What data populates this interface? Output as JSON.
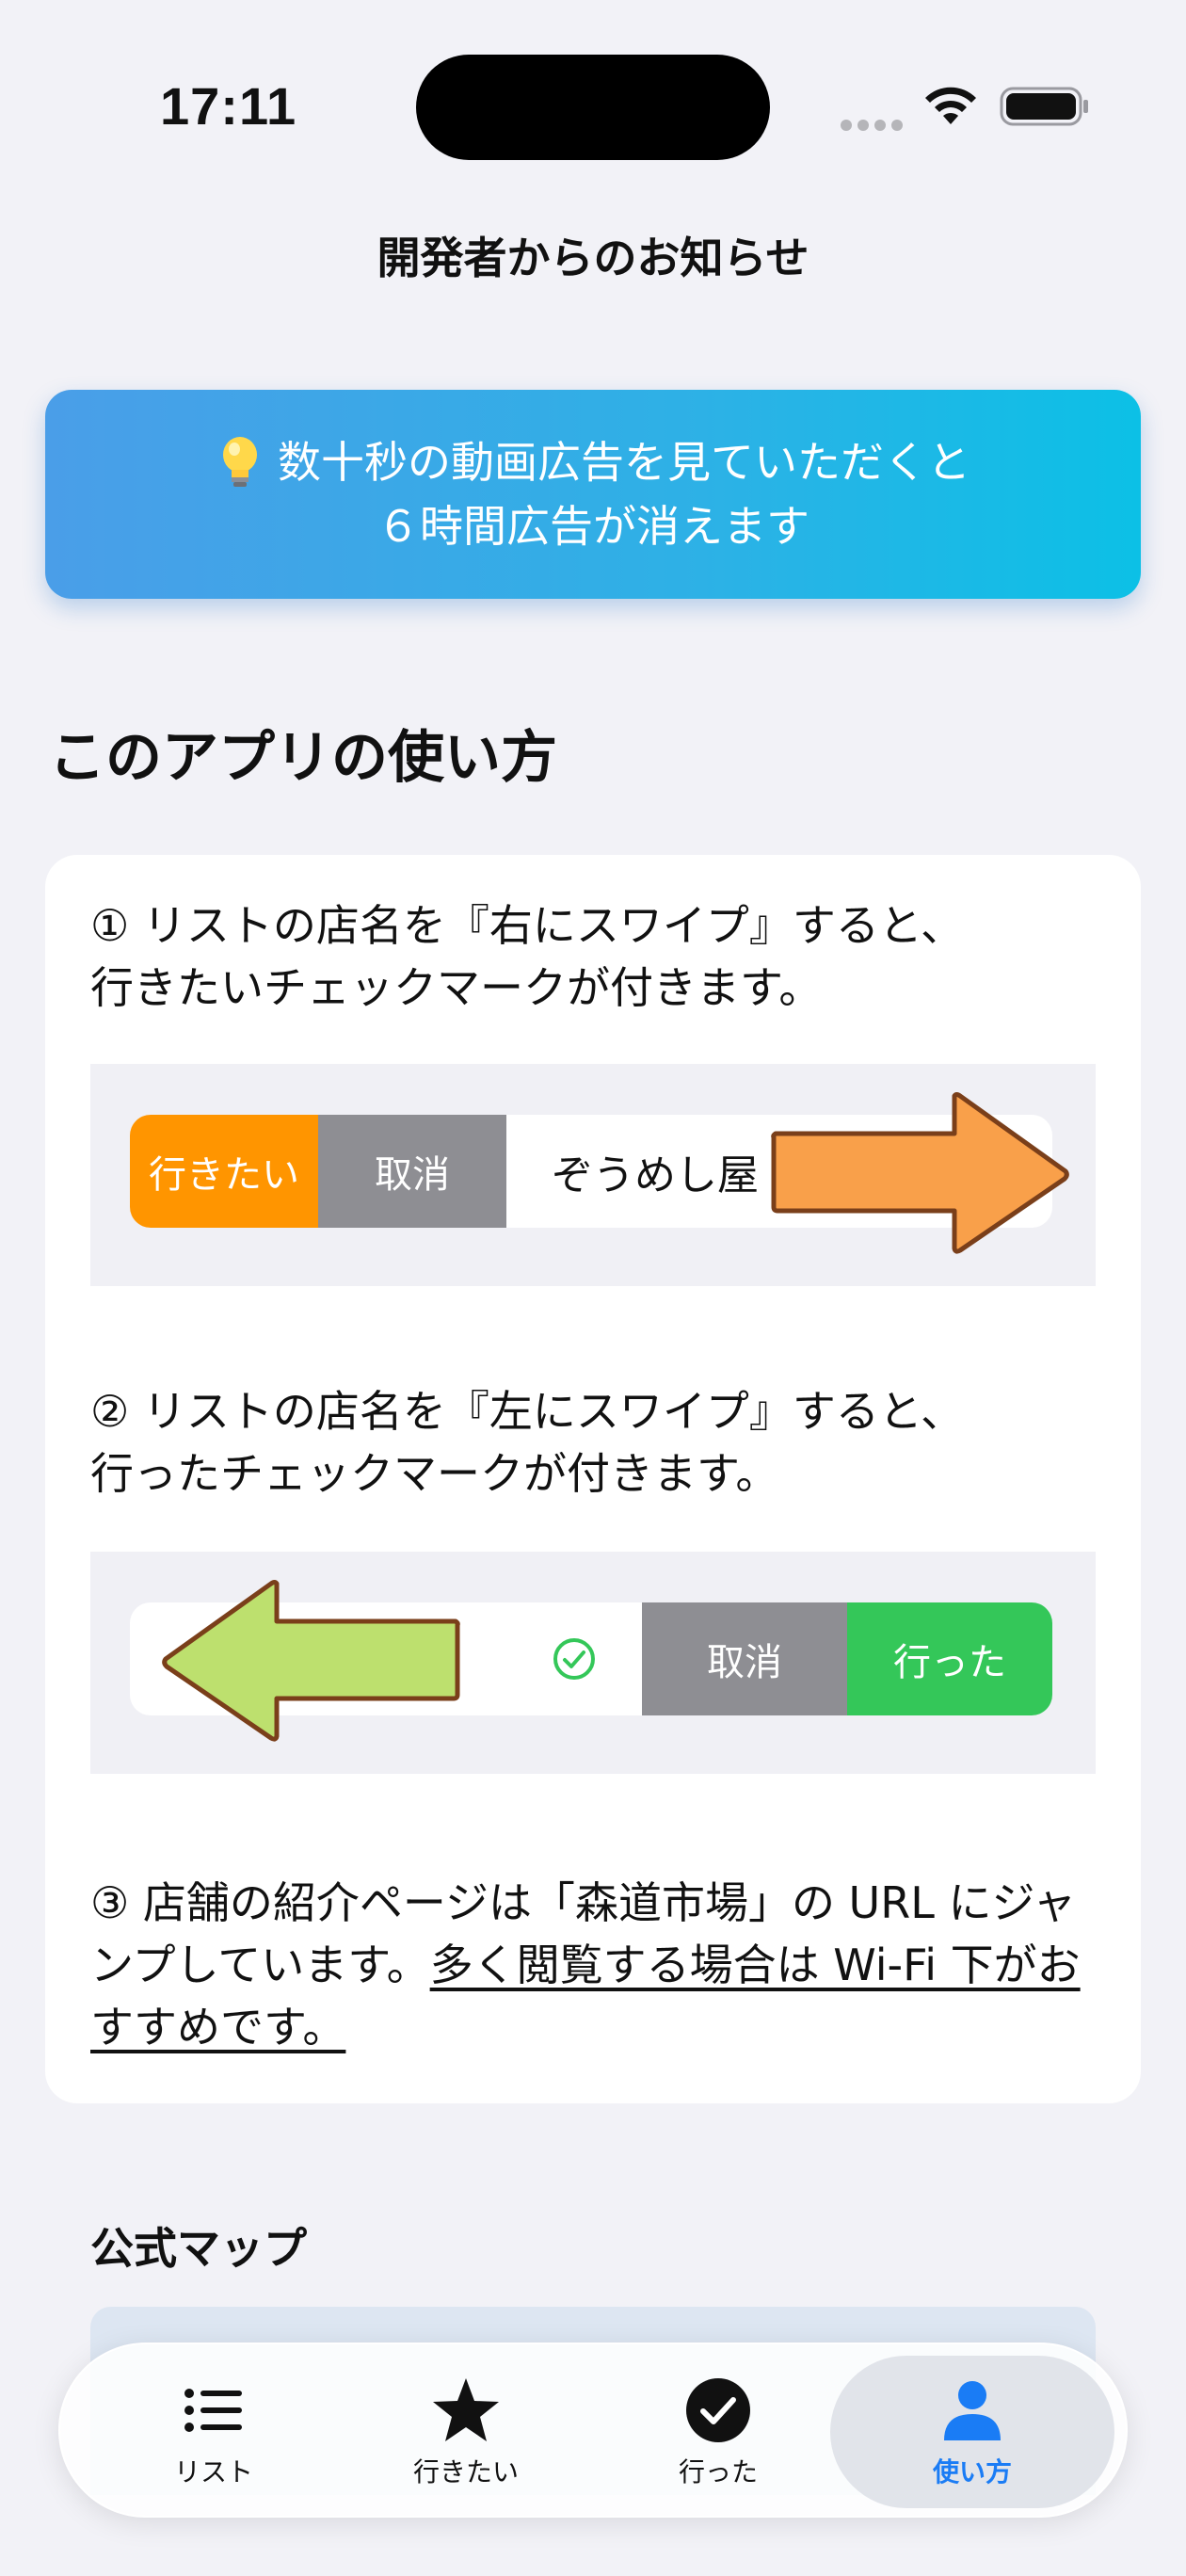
{
  "status_bar": {
    "time": "17:11"
  },
  "nav": {
    "title": "開発者からのお知らせ"
  },
  "ad_banner": {
    "line1": "数十秒の動画広告を見ていただくと",
    "line2": "６時間広告が消えます",
    "icon": "lightbulb-icon"
  },
  "howto": {
    "heading": "このアプリの使い方",
    "step1": {
      "line1": "① リストの店名を『右にスワイプ』すると、",
      "line2": "行きたいチェックマークが付きます。",
      "demo": {
        "want_label": "行きたい",
        "cancel_label": "取消",
        "shop_name": "ぞうめし屋"
      }
    },
    "step2": {
      "line1": "② リストの店名を『左にスワイプ』すると、",
      "line2": "行ったチェックマークが付きます。",
      "demo": {
        "cancel_label": "取消",
        "went_label": "行った"
      }
    },
    "step3": {
      "text": "③ 店舗の紹介ページは「森道市場」の URL にジャンプしています。",
      "underlined": "多く閲覧する場合は Wi-Fi 下がおすすめです。"
    }
  },
  "map": {
    "title": "公式マップ"
  },
  "tab_bar": {
    "tabs": [
      {
        "label": "リスト",
        "icon": "list-icon"
      },
      {
        "label": "行きたい",
        "icon": "star-icon"
      },
      {
        "label": "行った",
        "icon": "checkmark-circle-icon"
      },
      {
        "label": "使い方",
        "icon": "person-icon",
        "selected": true
      }
    ]
  },
  "colors": {
    "want": "#ff9500",
    "went": "#34c759",
    "cancel": "#8e8e93",
    "accent": "#1a7cf5",
    "banner_start": "#4a9ee8",
    "banner_end": "#0cc0e6"
  }
}
